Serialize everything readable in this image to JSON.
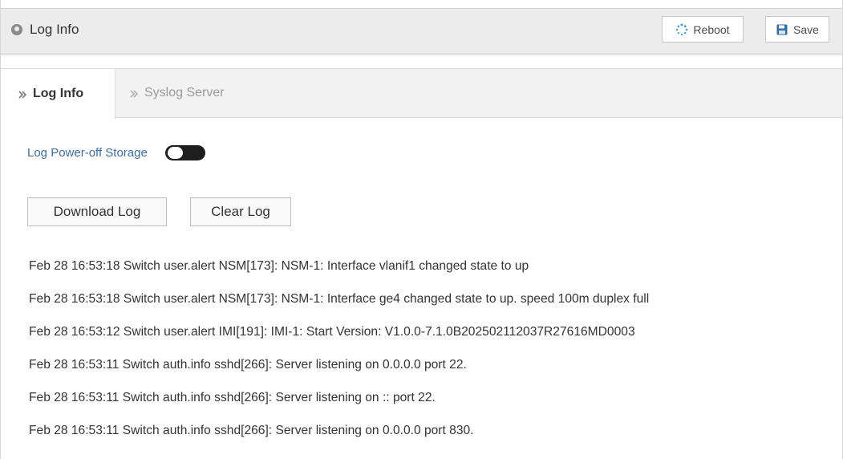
{
  "header": {
    "title": "Log Info",
    "reboot_label": "Reboot",
    "save_label": "Save"
  },
  "tabs": [
    {
      "label": "Log Info",
      "active": true
    },
    {
      "label": "Syslog Server",
      "active": false
    }
  ],
  "settings": {
    "power_off_storage_label": "Log Power-off Storage",
    "power_off_storage_enabled": false
  },
  "actions": {
    "download_label": "Download Log",
    "clear_label": "Clear Log"
  },
  "logs": [
    "Feb 28 16:53:18 Switch user.alert NSM[173]: NSM-1: Interface vlanif1 changed state to up",
    "Feb 28 16:53:18 Switch user.alert NSM[173]: NSM-1: Interface ge4 changed state to up. speed 100m duplex full",
    "Feb 28 16:53:12 Switch user.alert IMI[191]: IMI-1: Start Version: V1.0.0-7.1.0B202502112037R27616MD0003",
    "Feb 28 16:53:11 Switch auth.info sshd[266]: Server listening on 0.0.0.0 port 22.",
    "Feb 28 16:53:11 Switch auth.info sshd[266]: Server listening on :: port 22.",
    "Feb 28 16:53:11 Switch auth.info sshd[266]: Server listening on 0.0.0.0 port 830."
  ],
  "colors": {
    "link": "#3c6ea6",
    "toggle_bg": "#1e1e1e",
    "reboot_icon": "#3aa0c9",
    "save_icon": "#2f6fa8"
  },
  "icons": {
    "title_icon": "location-pin-icon",
    "reboot_icon": "spinner-icon",
    "save_icon": "floppy-disk-icon",
    "tab_icon": "chevron-right-icon"
  }
}
